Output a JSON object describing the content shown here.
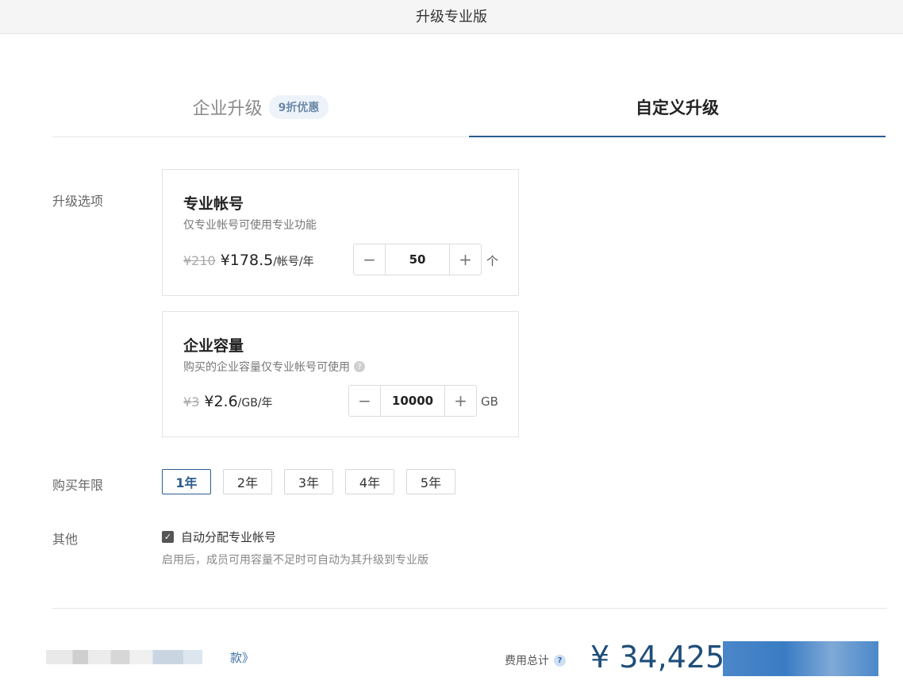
{
  "window": {
    "title": "升级专业版"
  },
  "tabs": [
    {
      "label": "企业升级",
      "badge": "9折优惠",
      "active": false
    },
    {
      "label": "自定义升级",
      "active": true
    }
  ],
  "upgrade_options": {
    "label": "升级选项",
    "accounts": {
      "title": "专业帐号",
      "description": "仅专业帐号可使用专业功能",
      "old_price": "¥210",
      "new_price": "¥178.5",
      "unit": "/帐号/年",
      "quantity": "50",
      "quantity_unit": "个"
    },
    "storage": {
      "title": "企业容量",
      "description": "购买的企业容量仅专业帐号可使用",
      "old_price": "¥3",
      "new_price": "¥2.6",
      "unit": "/GB/年",
      "quantity": "10000",
      "quantity_unit": "GB"
    }
  },
  "duration": {
    "label": "购买年限",
    "options": [
      "1年",
      "2年",
      "3年",
      "4年",
      "5年"
    ],
    "selected": "1年"
  },
  "other": {
    "label": "其他",
    "checkbox_label": "自动分配专业帐号",
    "checked": true,
    "hint": "启用后，成员可用容量不足时可自动为其升级到专业版"
  },
  "footer": {
    "link_tail": "款》",
    "total_label": "费用总计",
    "total_amount": "¥ 34,425"
  },
  "icons": {
    "minus": "minus-icon",
    "plus": "plus-icon",
    "help": "question-icon",
    "check": "check-icon"
  },
  "colors": {
    "accent": "#2c5d90",
    "amount": "#1f4e79",
    "button": "#3a7cc4"
  }
}
